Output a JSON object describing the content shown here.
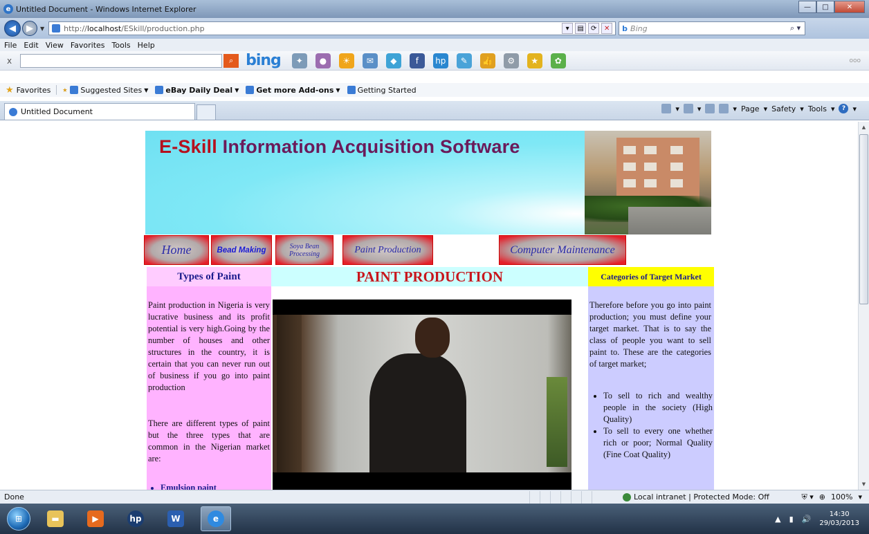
{
  "window": {
    "title": "Untitled Document - Windows Internet Explorer",
    "address": "http://localhost/ESkill/production.php",
    "address_prefix": "http://",
    "address_host": "localhost",
    "address_path": "/ESkill/production.php",
    "search_engine": "Bing",
    "search_placeholder": "Bing"
  },
  "menu": [
    "File",
    "Edit",
    "View",
    "Favorites",
    "Tools",
    "Help"
  ],
  "bing_toolbar": {
    "close": "x",
    "logo": "bing",
    "more": "ooo"
  },
  "favorites_bar": {
    "label": "Favorites",
    "items": [
      {
        "label": "Suggested Sites",
        "bold": false,
        "dropdown": true
      },
      {
        "label": "eBay Daily Deal",
        "bold": true,
        "dropdown": true
      },
      {
        "label": "Get more Add-ons",
        "bold": true,
        "dropdown": true
      },
      {
        "label": "Getting Started",
        "bold": false,
        "dropdown": false
      }
    ]
  },
  "tabs": [
    {
      "label": "Untitled Document"
    }
  ],
  "command_bar": [
    "Page",
    "Safety",
    "Tools"
  ],
  "page": {
    "banner_title_e": "E-Skill",
    "banner_title_rest": " Information Acquisition Software",
    "nav": [
      {
        "label": "Home"
      },
      {
        "label": "Bead Making"
      },
      {
        "label": "Soya Bean Processing"
      },
      {
        "label": "Paint Production"
      },
      {
        "label": "Computer Maintenance"
      }
    ],
    "left": {
      "heading": "Types of Paint",
      "p1": "Paint production in Nigeria is very lucrative business and its profit potential is very high.Going by the number of houses and other structures in the country, it is certain that you can never run out of business if you go into paint production",
      "p2": "There are different types of paint but the three types that are common in the Nigerian market are:",
      "list": [
        "Emulsion paint"
      ]
    },
    "center": {
      "heading": "PAINT PRODUCTION"
    },
    "right": {
      "heading": "Categories of Target Market",
      "p1": "Therefore before you go into paint production; you must define your target market. That is to say the class of people you want to sell paint to. These are the categories of target market;",
      "list": [
        "To sell to rich and wealthy people in the society (High Quality)",
        "To sell to every one whether rich or poor; Normal Quality (Fine Coat Quality)"
      ]
    }
  },
  "statusbar": {
    "text": "Done",
    "zone": "Local intranet | Protected Mode: Off",
    "zoom": "100%"
  },
  "taskbar": {
    "time": "14:30",
    "date": "29/03/2013"
  }
}
